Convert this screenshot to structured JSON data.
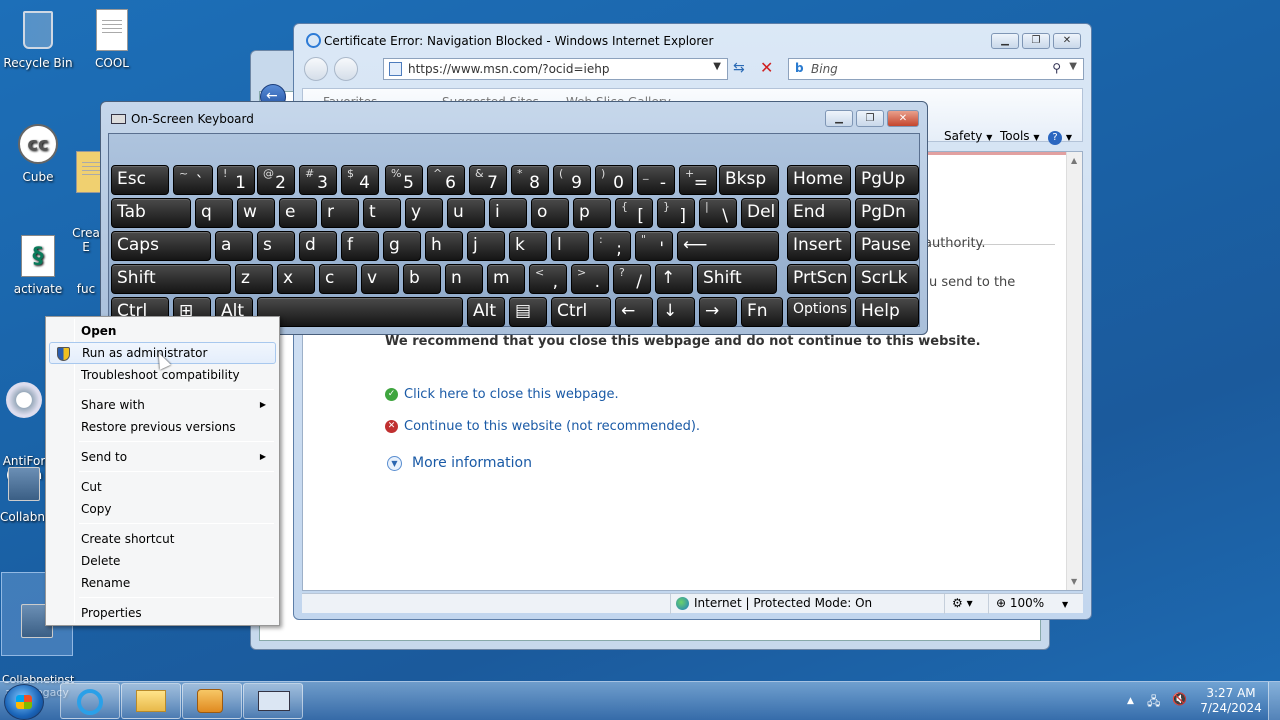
{
  "desktop": {
    "icons": [
      {
        "label": "Recycle Bin"
      },
      {
        "label": "COOL"
      },
      {
        "label": "Cube"
      },
      {
        "label": "Crea\nE"
      },
      {
        "label": "activate"
      },
      {
        "label": "fuc"
      },
      {
        "label": "AntiFor\n(norm"
      },
      {
        "label": "Collabne"
      },
      {
        "label": "Collabnetinst\naller legacy"
      }
    ]
  },
  "ie": {
    "title": "Certificate Error: Navigation Blocked - Windows Internet Explorer",
    "address": "https://www.msn.com/?ocid=iehp",
    "search_placeholder": "Bing",
    "search_brand": "b",
    "toolbar": {
      "favorites": "Favorites",
      "suggested": "Suggested Sites",
      "webslice": "Web Slice Gallery",
      "safety": "Safety",
      "tools": "Tools"
    },
    "content": {
      "authority_tail": "authority.",
      "send_tail": "u send to the",
      "recommend": "We recommend that you close this webpage and do not continue to this website.",
      "close_link": "Click here to close this webpage.",
      "continue_link": "Continue to this website (not recommended).",
      "more_info": "More information"
    },
    "status": {
      "zone": "Internet | Protected Mode: On",
      "zoom": "100%"
    }
  },
  "osk": {
    "title": "On-Screen Keyboard",
    "rows": [
      [
        {
          "main": "Esc"
        },
        {
          "sh": "~",
          "lo": "`"
        },
        {
          "sh": "!",
          "lo": "1"
        },
        {
          "sh": "@",
          "lo": "2"
        },
        {
          "sh": "#",
          "lo": "3"
        },
        {
          "sh": "$",
          "lo": "4"
        },
        {
          "sh": "%",
          "lo": "5"
        },
        {
          "sh": "^",
          "lo": "6"
        },
        {
          "sh": "&",
          "lo": "7"
        },
        {
          "sh": "*",
          "lo": "8"
        },
        {
          "sh": "(",
          "lo": "9"
        },
        {
          "sh": ")",
          "lo": "0"
        },
        {
          "sh": "_",
          "lo": "-"
        },
        {
          "sh": "+",
          "lo": "="
        },
        {
          "main": "Bksp"
        },
        {
          "main": "Home"
        },
        {
          "main": "PgUp"
        }
      ],
      [
        {
          "main": "Tab"
        },
        {
          "main": "q"
        },
        {
          "main": "w"
        },
        {
          "main": "e"
        },
        {
          "main": "r"
        },
        {
          "main": "t"
        },
        {
          "main": "y"
        },
        {
          "main": "u"
        },
        {
          "main": "i"
        },
        {
          "main": "o"
        },
        {
          "main": "p"
        },
        {
          "sh": "{",
          "lo": "["
        },
        {
          "sh": "}",
          "lo": "]"
        },
        {
          "sh": "|",
          "lo": "\\"
        },
        {
          "main": "Del"
        },
        {
          "main": "End"
        },
        {
          "main": "PgDn"
        }
      ],
      [
        {
          "main": "Caps"
        },
        {
          "main": "a"
        },
        {
          "main": "s"
        },
        {
          "main": "d"
        },
        {
          "main": "f"
        },
        {
          "main": "g"
        },
        {
          "main": "h"
        },
        {
          "main": "j"
        },
        {
          "main": "k"
        },
        {
          "main": "l"
        },
        {
          "sh": ":",
          "lo": ";"
        },
        {
          "sh": "\"",
          "lo": "'"
        },
        {
          "main": "⟵"
        },
        {
          "main": "Insert"
        },
        {
          "main": "Pause"
        }
      ],
      [
        {
          "main": "Shift"
        },
        {
          "main": "z"
        },
        {
          "main": "x"
        },
        {
          "main": "c"
        },
        {
          "main": "v"
        },
        {
          "main": "b"
        },
        {
          "main": "n"
        },
        {
          "main": "m"
        },
        {
          "sh": "<",
          "lo": ","
        },
        {
          "sh": ">",
          "lo": "."
        },
        {
          "sh": "?",
          "lo": "/"
        },
        {
          "main": "↑"
        },
        {
          "main": "Shift"
        },
        {
          "main": "PrtScn"
        },
        {
          "main": "ScrLk"
        }
      ],
      [
        {
          "main": "Ctrl"
        },
        {
          "main": "⊞"
        },
        {
          "main": "Alt"
        },
        {
          "main": ""
        },
        {
          "main": "Alt"
        },
        {
          "main": "▤"
        },
        {
          "main": "Ctrl"
        },
        {
          "main": "←"
        },
        {
          "main": "↓"
        },
        {
          "main": "→"
        },
        {
          "main": "Fn"
        },
        {
          "main": "Options"
        },
        {
          "main": "Help"
        }
      ]
    ]
  },
  "context_menu": {
    "items": [
      {
        "label": "Open"
      },
      {
        "label": "Run as administrator"
      },
      {
        "label": "Troubleshoot compatibility"
      },
      {
        "label": "Share with"
      },
      {
        "label": "Restore previous versions"
      },
      {
        "label": "Send to"
      },
      {
        "label": "Cut"
      },
      {
        "label": "Copy"
      },
      {
        "label": "Create shortcut"
      },
      {
        "label": "Delete"
      },
      {
        "label": "Rename"
      },
      {
        "label": "Properties"
      }
    ]
  },
  "taskbar": {
    "time": "3:27 AM",
    "date": "7/24/2024"
  }
}
